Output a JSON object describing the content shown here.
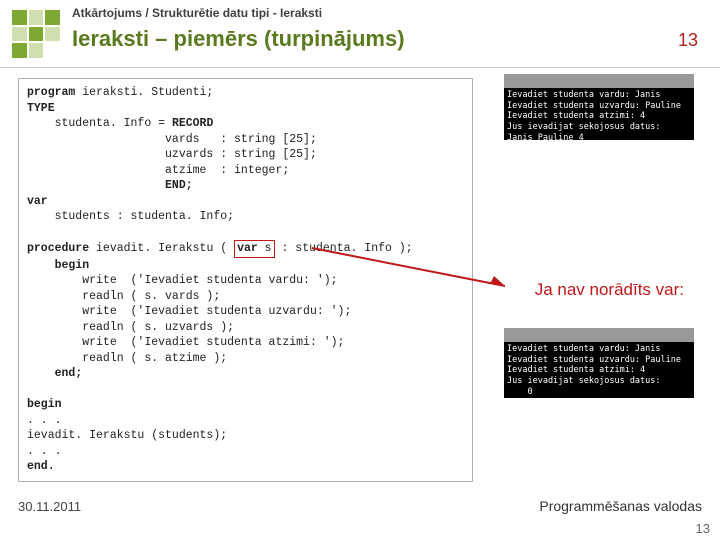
{
  "header": {
    "breadcrumb": "Atkārtojums / Strukturētie datu tipi - Ieraksti",
    "title": "Ieraksti – piemērs (turpinājums)",
    "slide_number": "13"
  },
  "code": {
    "line1a": "program",
    "line1b": " ieraksti. Studenti;",
    "line2": "TYPE",
    "line3a": "    studenta. Info = ",
    "line3b": "RECORD",
    "line4": "                    vards   : string [25];",
    "line5": "                    uzvards : string [25];",
    "line6": "                    atzime  : integer;",
    "line7a": "                    ",
    "line7b": "END;",
    "line8": "var",
    "line9": "    students : studenta. Info;",
    "blank1": "",
    "line10a": "procedure",
    "line10b": " ievadit. Ierakstu ( ",
    "line10c": "var",
    "line10d": " s",
    "line10e": " : studenta. Info );",
    "line11a": "    ",
    "line11b": "begin",
    "line12": "        write  ('Ievadiet studenta vardu: ');",
    "line13": "        readln ( s. vards );",
    "line14": "        write  ('Ievadiet studenta uzvardu: ');",
    "line15": "        readln ( s. uzvards );",
    "line16": "        write  ('Ievadiet studenta atzimi: ');",
    "line17": "        readln ( s. atzime );",
    "line18a": "    ",
    "line18b": "end;",
    "blank2": "",
    "line19": "begin",
    "line20": ". . .",
    "line21": "ievadit. Ierakstu (students);",
    "line22": ". . .",
    "line23": "end."
  },
  "screenshot1": "Ievadiet studenta vardu: Janis\nIevadiet studenta uzvardu: Pauline\nIevadiet studenta atzimi: 4\nJus ievadijat sekojosus datus:\nJanis Pauline 4",
  "screenshot2": "Ievadiet studenta vardu: Janis\nIevadiet studenta uzvardu: Pauline\nIevadiet studenta atzimi: 4\nJus ievadijat sekojosus datus:\n    0",
  "annotation": "Ja nav norādīts var:",
  "footer": {
    "date": "30.11.2011",
    "right": "Programmēšanas valodas",
    "num": "13"
  }
}
